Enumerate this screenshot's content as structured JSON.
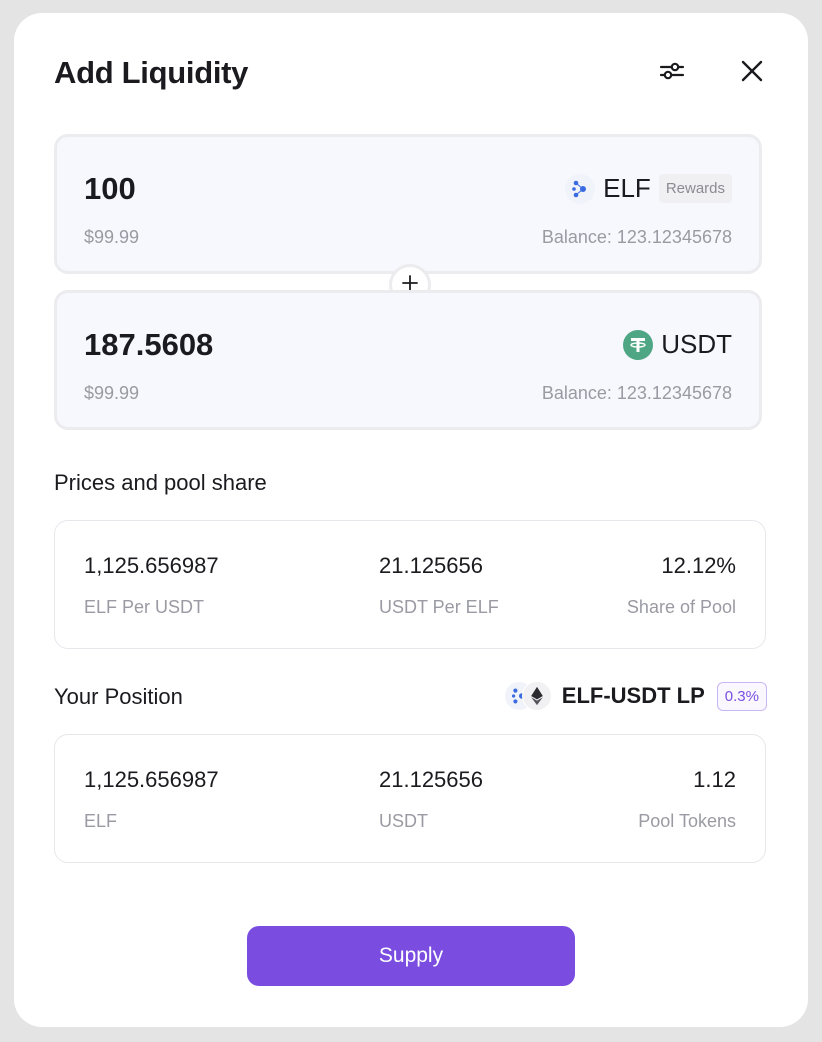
{
  "modal": {
    "title": "Add Liquidity"
  },
  "token_a": {
    "amount": "100",
    "usd_value": "$99.99",
    "symbol": "ELF",
    "badge": "Rewards",
    "balance": "Balance: 123.12345678",
    "icon": "elf-token-icon"
  },
  "token_b": {
    "amount": "187.5608",
    "usd_value": "$99.99",
    "symbol": "USDT",
    "balance": "Balance: 123.12345678",
    "icon": "usdt-token-icon"
  },
  "prices": {
    "title": "Prices and pool share",
    "items": [
      {
        "value": "1,125.656987",
        "label": "ELF Per USDT"
      },
      {
        "value": "21.125656",
        "label": "USDT Per ELF"
      },
      {
        "value": "12.12%",
        "label": "Share of Pool"
      }
    ]
  },
  "position": {
    "title": "Your Position",
    "pair_name": "ELF-USDT LP",
    "fee": "0.3%",
    "items": [
      {
        "value": "1,125.656987",
        "label": "ELF"
      },
      {
        "value": "21.125656",
        "label": "USDT"
      },
      {
        "value": "1.12",
        "label": "Pool Tokens"
      }
    ]
  },
  "actions": {
    "supply_label": "Supply"
  },
  "colors": {
    "accent": "#7a4de0",
    "usdt": "#4ea685",
    "elf": "#3a6be0"
  }
}
